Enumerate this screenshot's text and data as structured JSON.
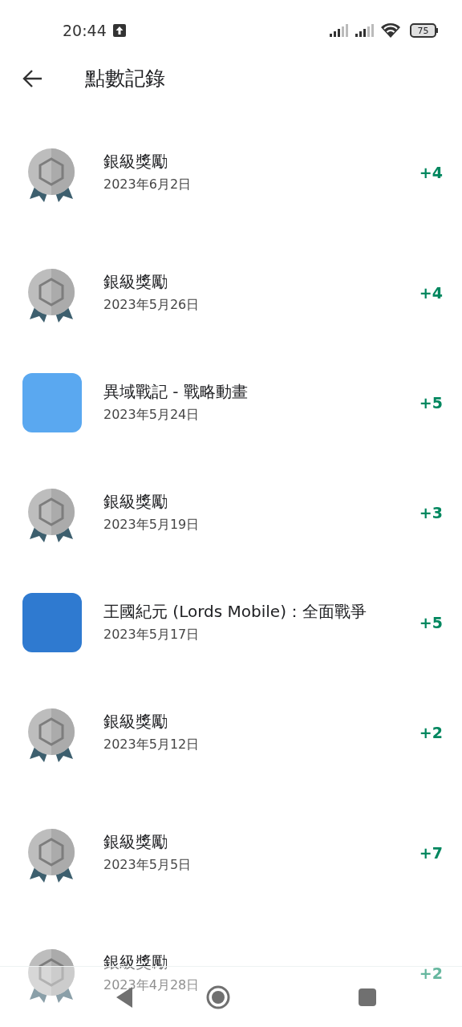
{
  "status_bar": {
    "time": "20:44",
    "battery": "75"
  },
  "header": {
    "title": "點數記錄"
  },
  "entries": [
    {
      "kind": "badge",
      "title": "銀級獎勵",
      "date": "2023年6月2日",
      "points": "+4"
    },
    {
      "kind": "badge",
      "title": "銀級獎勵",
      "date": "2023年5月26日",
      "points": "+4"
    },
    {
      "kind": "app",
      "title": "異域戰記 - 戰略動畫",
      "date": "2023年5月24日",
      "points": "+5",
      "color": "#5aa8f0"
    },
    {
      "kind": "badge",
      "title": "銀級獎勵",
      "date": "2023年5月19日",
      "points": "+3"
    },
    {
      "kind": "app",
      "title": "王國紀元 (Lords Mobile)：全面戰爭",
      "date": "2023年5月17日",
      "points": "+5",
      "color": "#2f7ad0"
    },
    {
      "kind": "badge",
      "title": "銀級獎勵",
      "date": "2023年5月12日",
      "points": "+2"
    },
    {
      "kind": "badge",
      "title": "銀級獎勵",
      "date": "2023年5月5日",
      "points": "+7"
    },
    {
      "kind": "badge",
      "title": "銀級獎勵",
      "date": "2023年4月28日",
      "points": "+2"
    }
  ]
}
